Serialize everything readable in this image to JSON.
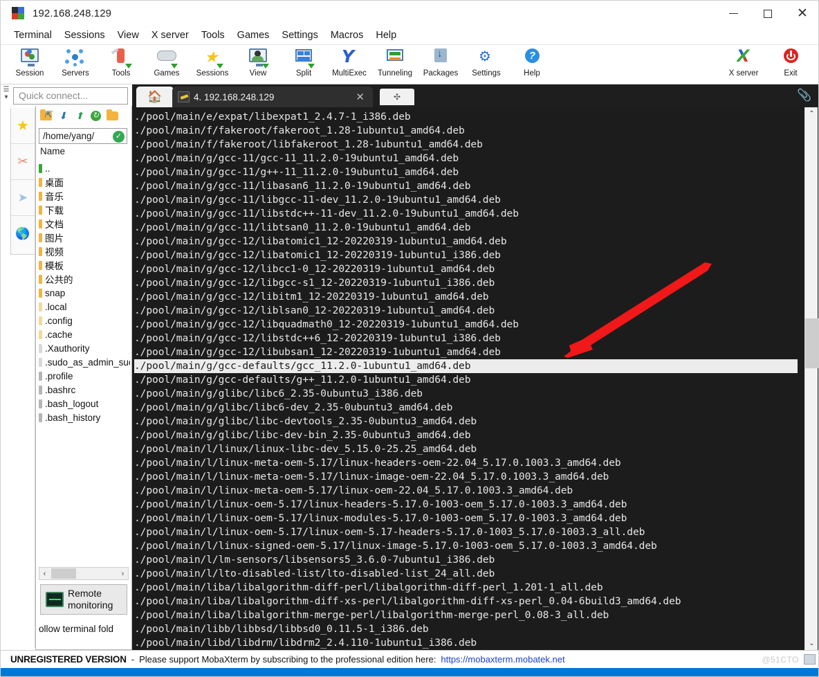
{
  "window": {
    "title": "192.168.248.129",
    "icon": "mobaxterm-logo-icon",
    "minimize": "—",
    "maximize": "☐",
    "close": "✕"
  },
  "menubar": {
    "items": [
      "Terminal",
      "Sessions",
      "View",
      "X server",
      "Tools",
      "Games",
      "Settings",
      "Macros",
      "Help"
    ]
  },
  "toolbar": {
    "left_items": [
      {
        "label": "Session",
        "icon": "session-icon"
      },
      {
        "label": "Servers",
        "icon": "servers-icon"
      },
      {
        "label": "Tools",
        "icon": "tools-icon"
      },
      {
        "label": "Games",
        "icon": "games-icon"
      },
      {
        "label": "Sessions",
        "icon": "sessions-star-icon"
      },
      {
        "label": "View",
        "icon": "view-icon"
      },
      {
        "label": "Split",
        "icon": "split-icon"
      },
      {
        "label": "MultiExec",
        "icon": "multiexec-icon"
      },
      {
        "label": "Tunneling",
        "icon": "tunneling-icon"
      },
      {
        "label": "Packages",
        "icon": "packages-icon"
      },
      {
        "label": "Settings",
        "icon": "settings-gear-icon"
      },
      {
        "label": "Help",
        "icon": "help-icon"
      }
    ],
    "right_items": [
      {
        "label": "X server",
        "icon": "x-server-icon"
      },
      {
        "label": "Exit",
        "icon": "exit-power-icon"
      }
    ]
  },
  "quick_connect": {
    "placeholder": "Quick connect...",
    "value": ""
  },
  "tabs": {
    "home_icon": "home-icon",
    "active": {
      "label": "4. 192.168.248.129",
      "icon": "ssh-key-icon",
      "close": "✕"
    },
    "new_tab": "✣"
  },
  "attach": {
    "icon": "paperclip-icon"
  },
  "rail": {
    "items": [
      {
        "icon": "star-bookmarks-icon",
        "label": "★"
      },
      {
        "icon": "tools-knife-icon",
        "label": ""
      },
      {
        "icon": "paper-plane-icon",
        "label": ""
      },
      {
        "icon": "globe-icon",
        "label": ""
      }
    ]
  },
  "file_browser": {
    "toolbar_icons": [
      "parent-folder-icon",
      "download-icon",
      "upload-icon",
      "refresh-icon",
      "new-folder-icon"
    ],
    "path": "/home/yang/",
    "path_ok_icon": "checkmark-icon",
    "column_header": "Name",
    "entries": [
      {
        "name": "..",
        "color": "#3aa63a"
      },
      {
        "name": "桌面",
        "color": "#f3b33d"
      },
      {
        "name": "音乐",
        "color": "#f3b33d"
      },
      {
        "name": "下载",
        "color": "#f3b33d"
      },
      {
        "name": "文档",
        "color": "#f3b33d"
      },
      {
        "name": "图片",
        "color": "#f3b33d"
      },
      {
        "name": "视频",
        "color": "#f3b33d"
      },
      {
        "name": "模板",
        "color": "#f3b33d"
      },
      {
        "name": "公共的",
        "color": "#f3b33d"
      },
      {
        "name": "snap",
        "color": "#f3b33d"
      },
      {
        "name": ".local",
        "color": "#f6d79a"
      },
      {
        "name": ".config",
        "color": "#f6d79a"
      },
      {
        "name": ".cache",
        "color": "#f6d79a"
      },
      {
        "name": ".Xauthority",
        "color": "#d8d8d8"
      },
      {
        "name": ".sudo_as_admin_succ",
        "color": "#d8d8d8"
      },
      {
        "name": ".profile",
        "color": "#b5b5b5"
      },
      {
        "name": ".bashrc",
        "color": "#b5b5b5"
      },
      {
        "name": ".bash_logout",
        "color": "#b5b5b5"
      },
      {
        "name": ".bash_history",
        "color": "#b5b5b5"
      }
    ],
    "hscroll": {
      "left": "‹",
      "right": "›"
    },
    "remote_monitoring": "Remote\nmonitoring",
    "remote_monitoring_label_line1": "Remote",
    "remote_monitoring_label_line2": "monitoring",
    "follow_terminal": "ollow terminal fold"
  },
  "terminal": {
    "highlight_index": 18,
    "highlight_bg": "#ececec",
    "bg": "#1c1c1c",
    "fg": "#e6e6e6",
    "lines": [
      "./pool/main/e/expat/libexpat1_2.4.7-1_i386.deb",
      "./pool/main/f/fakeroot/fakeroot_1.28-1ubuntu1_amd64.deb",
      "./pool/main/f/fakeroot/libfakeroot_1.28-1ubuntu1_amd64.deb",
      "./pool/main/g/gcc-11/gcc-11_11.2.0-19ubuntu1_amd64.deb",
      "./pool/main/g/gcc-11/g++-11_11.2.0-19ubuntu1_amd64.deb",
      "./pool/main/g/gcc-11/libasan6_11.2.0-19ubuntu1_amd64.deb",
      "./pool/main/g/gcc-11/libgcc-11-dev_11.2.0-19ubuntu1_amd64.deb",
      "./pool/main/g/gcc-11/libstdc++-11-dev_11.2.0-19ubuntu1_amd64.deb",
      "./pool/main/g/gcc-11/libtsan0_11.2.0-19ubuntu1_amd64.deb",
      "./pool/main/g/gcc-12/libatomic1_12-20220319-1ubuntu1_amd64.deb",
      "./pool/main/g/gcc-12/libatomic1_12-20220319-1ubuntu1_i386.deb",
      "./pool/main/g/gcc-12/libcc1-0_12-20220319-1ubuntu1_amd64.deb",
      "./pool/main/g/gcc-12/libgcc-s1_12-20220319-1ubuntu1_i386.deb",
      "./pool/main/g/gcc-12/libitm1_12-20220319-1ubuntu1_amd64.deb",
      "./pool/main/g/gcc-12/liblsan0_12-20220319-1ubuntu1_amd64.deb",
      "./pool/main/g/gcc-12/libquadmath0_12-20220319-1ubuntu1_amd64.deb",
      "./pool/main/g/gcc-12/libstdc++6_12-20220319-1ubuntu1_i386.deb",
      "./pool/main/g/gcc-12/libubsan1_12-20220319-1ubuntu1_amd64.deb",
      "./pool/main/g/gcc-defaults/gcc_11.2.0-1ubuntu1_amd64.deb",
      "./pool/main/g/gcc-defaults/g++_11.2.0-1ubuntu1_amd64.deb",
      "./pool/main/g/glibc/libc6_2.35-0ubuntu3_i386.deb",
      "./pool/main/g/glibc/libc6-dev_2.35-0ubuntu3_amd64.deb",
      "./pool/main/g/glibc/libc-devtools_2.35-0ubuntu3_amd64.deb",
      "./pool/main/g/glibc/libc-dev-bin_2.35-0ubuntu3_amd64.deb",
      "./pool/main/l/linux/linux-libc-dev_5.15.0-25.25_amd64.deb",
      "./pool/main/l/linux-meta-oem-5.17/linux-headers-oem-22.04_5.17.0.1003.3_amd64.deb",
      "./pool/main/l/linux-meta-oem-5.17/linux-image-oem-22.04_5.17.0.1003.3_amd64.deb",
      "./pool/main/l/linux-meta-oem-5.17/linux-oem-22.04_5.17.0.1003.3_amd64.deb",
      "./pool/main/l/linux-oem-5.17/linux-headers-5.17.0-1003-oem_5.17.0-1003.3_amd64.deb",
      "./pool/main/l/linux-oem-5.17/linux-modules-5.17.0-1003-oem_5.17.0-1003.3_amd64.deb",
      "./pool/main/l/linux-oem-5.17/linux-oem-5.17-headers-5.17.0-1003_5.17.0-1003.3_all.deb",
      "./pool/main/l/linux-signed-oem-5.17/linux-image-5.17.0-1003-oem_5.17.0-1003.3_amd64.deb",
      "./pool/main/l/lm-sensors/libsensors5_3.6.0-7ubuntu1_i386.deb",
      "./pool/main/l/lto-disabled-list/lto-disabled-list_24_all.deb",
      "./pool/main/liba/libalgorithm-diff-perl/libalgorithm-diff-perl_1.201-1_all.deb",
      "./pool/main/liba/libalgorithm-diff-xs-perl/libalgorithm-diff-xs-perl_0.04-6build3_amd64.deb",
      "./pool/main/liba/libalgorithm-merge-perl/libalgorithm-merge-perl_0.08-3_all.deb",
      "./pool/main/libb/libbsd/libbsd0_0.11.5-1_i386.deb",
      "./pool/main/libd/libdrm/libdrm2_2.4.110-1ubuntu1_i386.deb"
    ],
    "scrollbar": {
      "up": "⌃",
      "down": "⌄"
    }
  },
  "annotation": {
    "arrow_color": "#f01818",
    "name": "red-pointer-arrow"
  },
  "statusbar": {
    "unregistered": "UNREGISTERED VERSION",
    "dash": "-",
    "message": "Please support MobaXterm by subscribing to the professional edition here:",
    "link": "https://mobaxterm.mobatek.net",
    "watermark": "@51CTO"
  }
}
